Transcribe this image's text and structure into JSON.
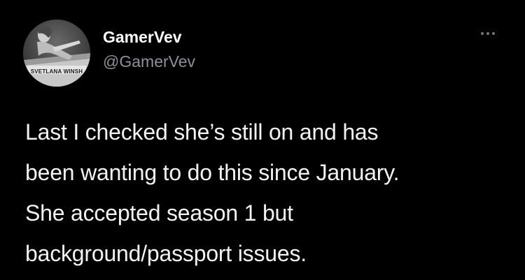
{
  "tweet": {
    "author": {
      "display_name": "GamerVev",
      "handle": "@GamerVev",
      "avatar_caption": "SVETLANA WINSH"
    },
    "text_lines": [
      "Last I checked she’s still on and has",
      "been wanting to do this since January.",
      "She accepted season 1 but",
      "background/passport issues."
    ],
    "menu_icon": "more-horizontal-icon"
  },
  "colors": {
    "background": "#000000",
    "text_primary": "#ffffff",
    "text_secondary": "#8b9199"
  }
}
